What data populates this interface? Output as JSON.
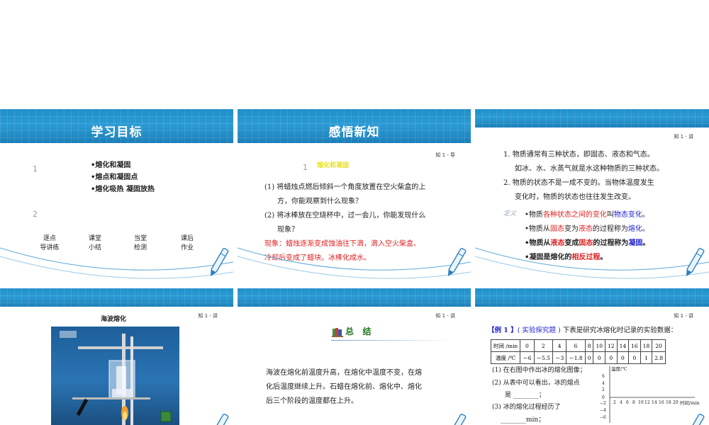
{
  "slides": {
    "s1": {
      "title": "学习目标",
      "num1": "1",
      "num2": "2",
      "bullets": [
        "•熔化和凝固",
        "•熔点和凝固点",
        "•熔化吸热  凝固放热"
      ],
      "nav": [
        {
          "l1": "逐点",
          "l2": "导讲练"
        },
        {
          "l1": "课堂",
          "l2": "小结"
        },
        {
          "l1": "当堂",
          "l2": "检测"
        },
        {
          "l1": "课后",
          "l2": "作业"
        }
      ]
    },
    "s2": {
      "title": "感悟新知",
      "lecture": "知 1 - 导",
      "num": "1",
      "heading": "熔化和凝固",
      "q1_a": "(1) 将蜡烛点燃后倾斜一个角度放置在空火柴盒的上",
      "q1_b": "方，你能观察到什么现象？",
      "q2_a": "(2) 将冰棒放在空烧杯中，过一会儿，你能发现什么",
      "q2_b": "现象？",
      "ans_a": "现象：蜡烛逐渐变成蚀油往下滴，滴入空火柴盒、",
      "ans_b": "冷却后变成了蜡块。冰棒化成水。"
    },
    "s3": {
      "lecture": "知 1 - 讲",
      "p1_a": "1.  物质通常有三种状态，即固态、液态和气态。",
      "p1_b": "如冰、水、水蒸气就是水这种物质的三种状态。",
      "p2_a": "2.  物质的状态不是一成不变的。当物体温度发生",
      "p2_b": "变化时，物质的状态也往往发生改变。",
      "def_label": "定义",
      "d1": [
        "•物质",
        "各种状态之间的变化",
        "叫",
        "物态变化",
        "。"
      ],
      "d2": [
        "•物质从",
        "固态",
        "变为",
        "液态",
        "的过程称为",
        "熔化",
        "。"
      ],
      "d3": [
        "•物质从",
        "液态",
        "变成",
        "固态",
        "的过程称为",
        "凝固",
        "。"
      ],
      "d4": [
        "•凝固是熔化的",
        "相反过程",
        "。"
      ]
    },
    "s4": {
      "lecture": "知 1 - 讲",
      "caption": "海波熔化"
    },
    "s5": {
      "lecture": "知 1 - 讲",
      "summary_title": "总   结",
      "line1": "海波在熔化前温度升高，在熔化中温度不变，在熔",
      "line2": "化后温度继续上升。石蜡在熔化前、熔化中、熔化",
      "line3": "后三个阶段的温度都在上升。"
    },
    "s6": {
      "lecture": "知 1 - 讲",
      "example_tag": "【例 1 】",
      "example_type": "( 实验探究题 )",
      "example_text": "下表是研究冰熔化时记录的实验数据：",
      "table": {
        "row1_label": "时间 /min",
        "row2_label": "温度 /℃",
        "times": [
          "0",
          "2",
          "4",
          "6",
          "8",
          "10",
          "12",
          "14",
          "16",
          "18",
          "20"
        ],
        "temps": [
          "－6",
          "－5.5",
          "－3",
          "－1.8",
          "0",
          "0",
          "0",
          "0",
          "0",
          "1",
          "2.8"
        ]
      },
      "q1": "(1) 在右图中作出冰的熔化图像；",
      "q2a": "(2) 从表中可以看出，冰的熔点",
      "q2b": "是 ________；",
      "q3a": "(3) 冰的熔化过程经历了",
      "q3b": "________min；",
      "graph": {
        "ylabel": "温度/℃",
        "xlabel": "时间/min",
        "yticks": [
          "6",
          "4",
          "2",
          "0",
          "−2",
          "−4",
          "−6"
        ],
        "xticks": [
          "2",
          "4",
          "6",
          "8",
          "10",
          "12",
          "14",
          "16",
          "18",
          "20"
        ]
      }
    }
  },
  "colors": {
    "banner": "#1f8fc8",
    "red": "#e02020",
    "blue": "#2020d0",
    "heading_yellow": "#e8e020"
  }
}
